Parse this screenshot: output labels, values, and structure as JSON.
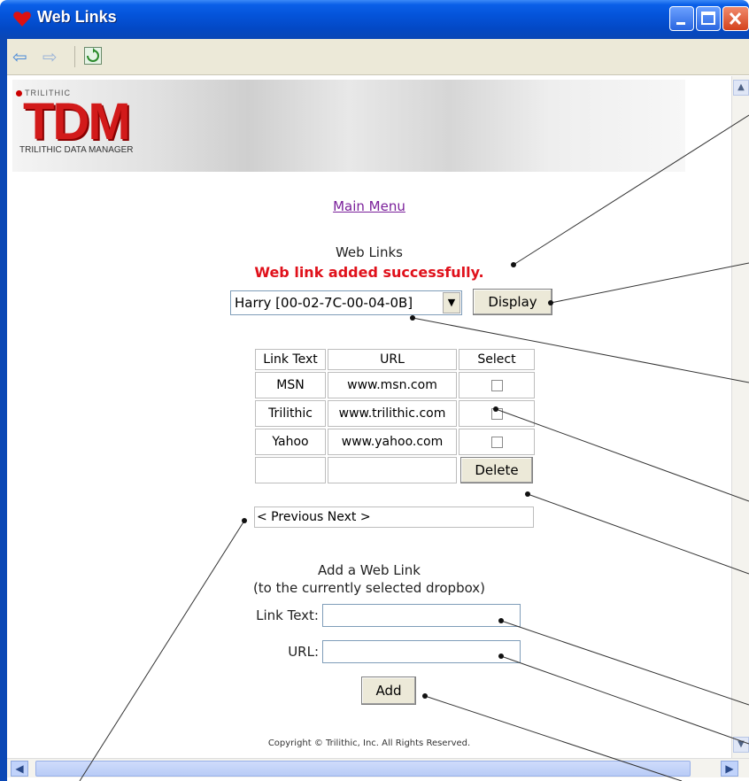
{
  "window": {
    "title": "Web Links"
  },
  "banner": {
    "brand_small": "TRILITHIC",
    "logo": "TDM",
    "logo_sub": "TRILITHIC DATA MANAGER"
  },
  "page": {
    "main_menu_link": "Main Menu",
    "heading": "Web Links",
    "status_message": "Web link added successfully.",
    "status_color": "#e0111b"
  },
  "dropbox": {
    "selected": "Harry [00-02-7C-00-04-0B]",
    "display_button": "Display"
  },
  "links_table": {
    "columns": [
      "Link Text",
      "URL",
      "Select"
    ],
    "rows": [
      {
        "text": "MSN",
        "url": "www.msn.com"
      },
      {
        "text": "Trilithic",
        "url": "www.trilithic.com"
      },
      {
        "text": "Yahoo",
        "url": "www.yahoo.com"
      }
    ],
    "delete_button": "Delete",
    "pager": "< Previous Next >"
  },
  "add_form": {
    "title_line1": "Add a Web Link",
    "title_line2": "(to the currently selected dropbox)",
    "link_text_label": "Link Text:",
    "url_label": "URL:",
    "link_text_value": "",
    "url_value": "",
    "add_button": "Add"
  },
  "footer": {
    "copyright": "Copyright © Trilithic, Inc. All Rights Reserved."
  }
}
